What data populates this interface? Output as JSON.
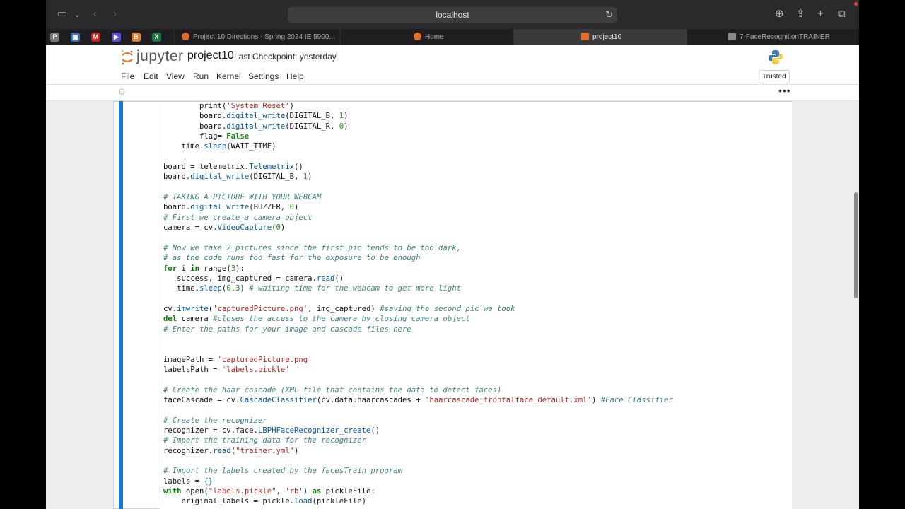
{
  "browser": {
    "url": "localhost",
    "tabs": [
      {
        "label": "Project 10 Directions - Spring 2024 IE 5900...",
        "icon_color": "#e06a2b"
      },
      {
        "label": "Home",
        "icon_color": "#e46d2a"
      },
      {
        "label": "project10",
        "icon_color": "#e46d2a"
      },
      {
        "label": "7-FaceRecognitionTRAINER",
        "icon_color": "#888888"
      }
    ],
    "favorites": [
      {
        "glyph": "P",
        "color": "#7a7a7a"
      },
      {
        "glyph": "▣",
        "color": "#3c6fb4"
      },
      {
        "glyph": "M",
        "color": "#c5221f"
      },
      {
        "glyph": "▶",
        "color": "#5b4fd6"
      },
      {
        "glyph": "B",
        "color": "#e07a2b"
      },
      {
        "glyph": "X",
        "color": "#1d7a3e"
      }
    ]
  },
  "jupyter": {
    "logo_word": "jupyter",
    "notebook_name": "project10",
    "checkpoint": "Last Checkpoint: yesterday",
    "menu": [
      "File",
      "Edit",
      "View",
      "Run",
      "Kernel",
      "Settings",
      "Help"
    ],
    "trusted": "Trusted"
  },
  "code_lines": [
    "        print('System Reset')",
    "        board.digital_write(DIGITAL_B, 1)",
    "        board.digital_write(DIGITAL_R, 0)",
    "        flag= False",
    "    time.sleep(WAIT_TIME)",
    "",
    "board = telemetrix.Telemetrix()",
    "board.digital_write(DIGITAL_B, 1)",
    "",
    "# TAKING A PICTURE WITH YOUR WEBCAM",
    "board.digital_write(BUZZER, 0)",
    "# First we create a camera object",
    "camera = cv.VideoCapture(0)",
    "",
    "# Now we take 2 pictures since the first pic tends to be too dark,",
    "# as the code runs too fast for the exposure to be enough",
    "for i in range(3):",
    "   success, img_captured = camera.read()",
    "   time.sleep(0.3) # waiting time for the webcam to get more light",
    "",
    "cv.imwrite('capturedPicture.png', img_captured) #saving the second pic we took",
    "del camera #closes the access to the camera by closing camera object",
    "# Enter the paths for your image and cascade files here",
    "",
    "",
    "imagePath = 'capturedPicture.png'",
    "labelsPath = 'labels.pickle'",
    "",
    "# Create the haar cascade (XML file that contains the data to detect faces)",
    "faceCascade = cv.CascadeClassifier(cv.data.haarcascades + 'haarcascade_frontalface_default.xml') #Face Classifier",
    "",
    "# Create the recognizer",
    "recognizer = cv.face.LBPHFaceRecognizer_create()",
    "# Import the training data for the recognizer",
    "recognizer.read(\"trainer.yml\")",
    "",
    "# Import the labels created by the facesTrain program",
    "labels = {}",
    "with open(\"labels.pickle\", 'rb') as pickleFile:",
    "    original_labels = pickle.load(pickleFile)"
  ]
}
